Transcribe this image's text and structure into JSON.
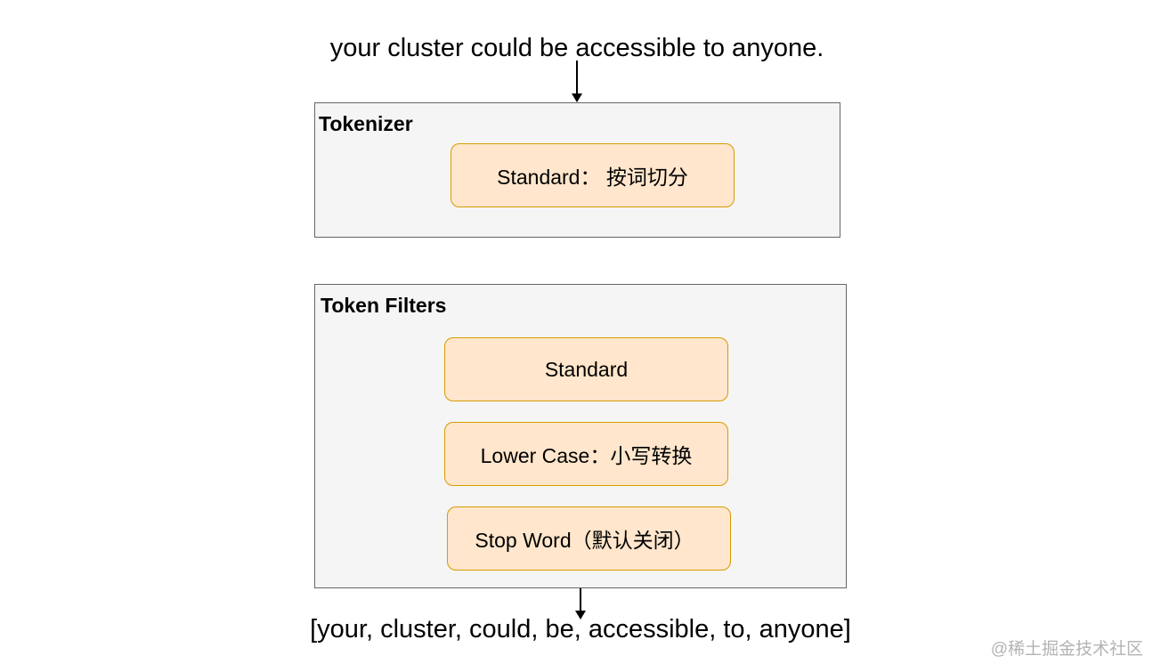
{
  "input_text": "your cluster could be accessible to anyone.",
  "tokenizer": {
    "title": "Tokenizer",
    "steps": [
      {
        "label": "Standard：  按词切分"
      }
    ]
  },
  "token_filters": {
    "title": "Token Filters",
    "steps": [
      {
        "label": "Standard"
      },
      {
        "label": "Lower Case：小写转换"
      },
      {
        "label": "Stop Word（默认关闭）"
      }
    ]
  },
  "output_text": "[your, cluster, could, be, accessible, to, anyone]",
  "watermark": "@稀土掘金技术社区",
  "colors": {
    "stage_fill": "#f5f5f5",
    "stage_border": "#666666",
    "step_fill": "#ffe6cc",
    "step_border": "#d79b00"
  }
}
